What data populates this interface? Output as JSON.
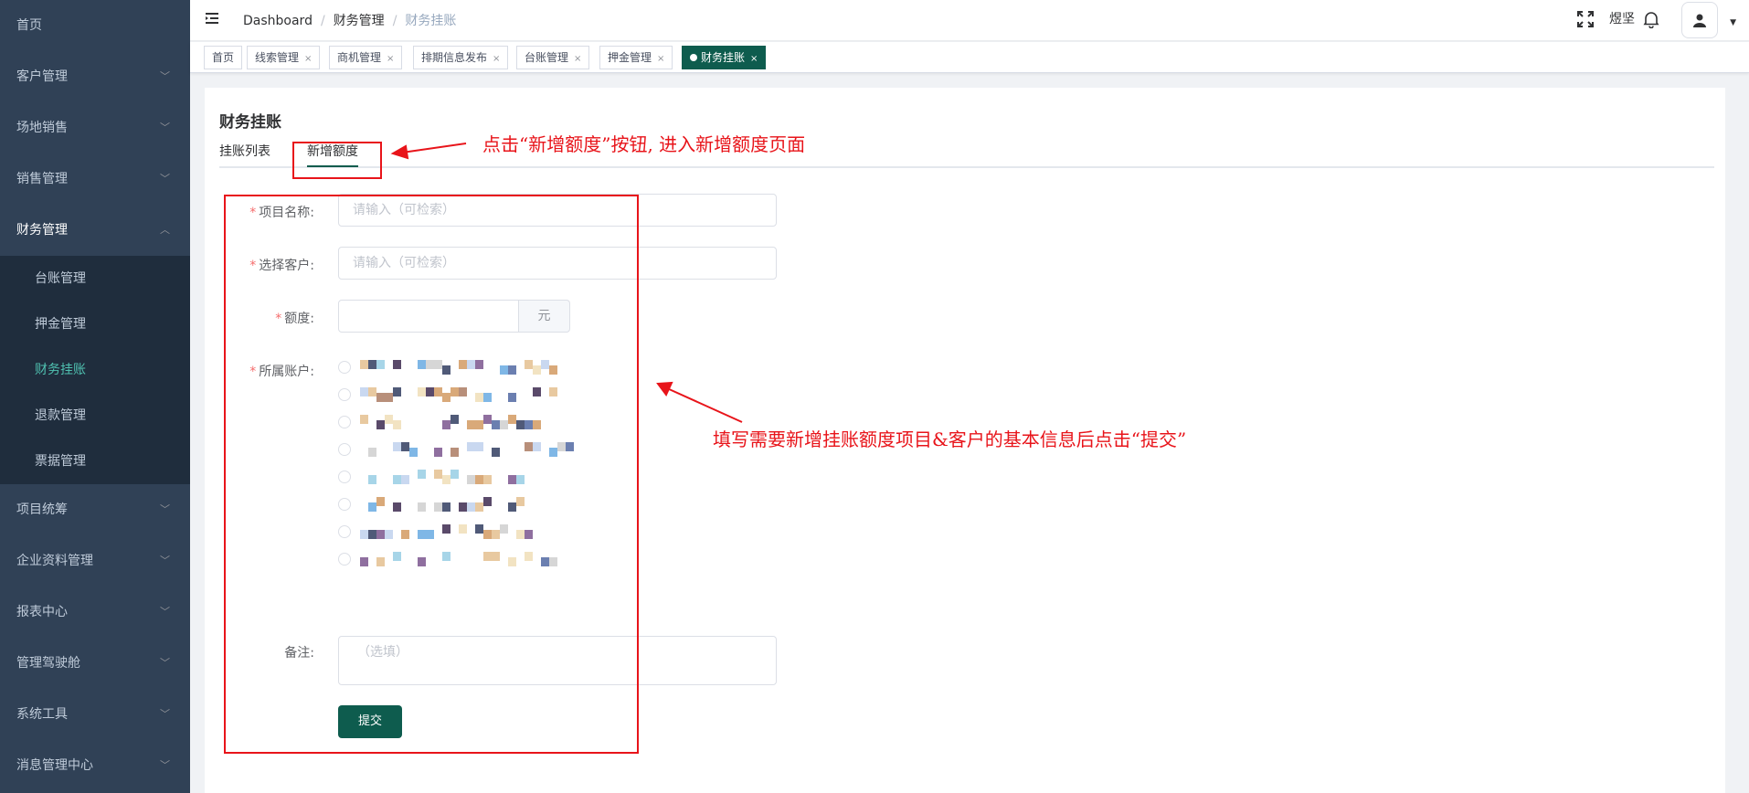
{
  "sidebar": {
    "items": [
      {
        "label": "首页",
        "has_children": false
      },
      {
        "label": "客户管理",
        "has_children": true
      },
      {
        "label": "场地销售",
        "has_children": true
      },
      {
        "label": "销售管理",
        "has_children": true
      },
      {
        "label": "财务管理",
        "has_children": true,
        "open": true
      },
      {
        "label": "项目统筹",
        "has_children": true
      },
      {
        "label": "企业资料管理",
        "has_children": true
      },
      {
        "label": "报表中心",
        "has_children": true
      },
      {
        "label": "管理驾驶舱",
        "has_children": true
      },
      {
        "label": "系统工具",
        "has_children": true
      },
      {
        "label": "消息管理中心",
        "has_children": true
      }
    ],
    "submenu": [
      "台账管理",
      "押金管理",
      "财务挂账",
      "退款管理",
      "票据管理"
    ],
    "active_submenu": "财务挂账"
  },
  "navbar": {
    "breadcrumb": [
      "Dashboard",
      "财务管理",
      "财务挂账"
    ],
    "username": "煜坚"
  },
  "tags": [
    {
      "label": "首页",
      "closable": false,
      "active": false
    },
    {
      "label": "线索管理",
      "closable": true,
      "active": false
    },
    {
      "label": "商机管理",
      "closable": true,
      "active": false
    },
    {
      "label": "排期信息发布",
      "closable": true,
      "active": false
    },
    {
      "label": "台账管理",
      "closable": true,
      "active": false
    },
    {
      "label": "押金管理",
      "closable": true,
      "active": false
    },
    {
      "label": "财务挂账",
      "closable": true,
      "active": true
    }
  ],
  "page": {
    "title": "财务挂账",
    "tabs": [
      "挂账列表",
      "新增额度"
    ],
    "active_tab": "新增额度"
  },
  "form": {
    "project_label": "项目名称:",
    "project_placeholder": "请输入（可检索）",
    "customer_label": "选择客户:",
    "customer_placeholder": "请输入（可检索）",
    "amount_label": "额度:",
    "amount_unit": "元",
    "account_label": "所属账户:",
    "account_option_count": 8,
    "remark_label": "备注:",
    "remark_placeholder": "（选填）",
    "submit_label": "提交",
    "required_mark": "*"
  },
  "annotations": {
    "tab_note": "点击“新增额度”按钮, 进入新增额度页面",
    "form_note": "填写需要新增挂账额度项目&客户的基本信息后点击“提交”",
    "color": "#e8141a"
  },
  "colors": {
    "sidebar_bg": "#304156",
    "submenu_bg": "#1f2d3d",
    "primary": "#0e5c4e",
    "active_menu_text": "#4fc0b0"
  }
}
